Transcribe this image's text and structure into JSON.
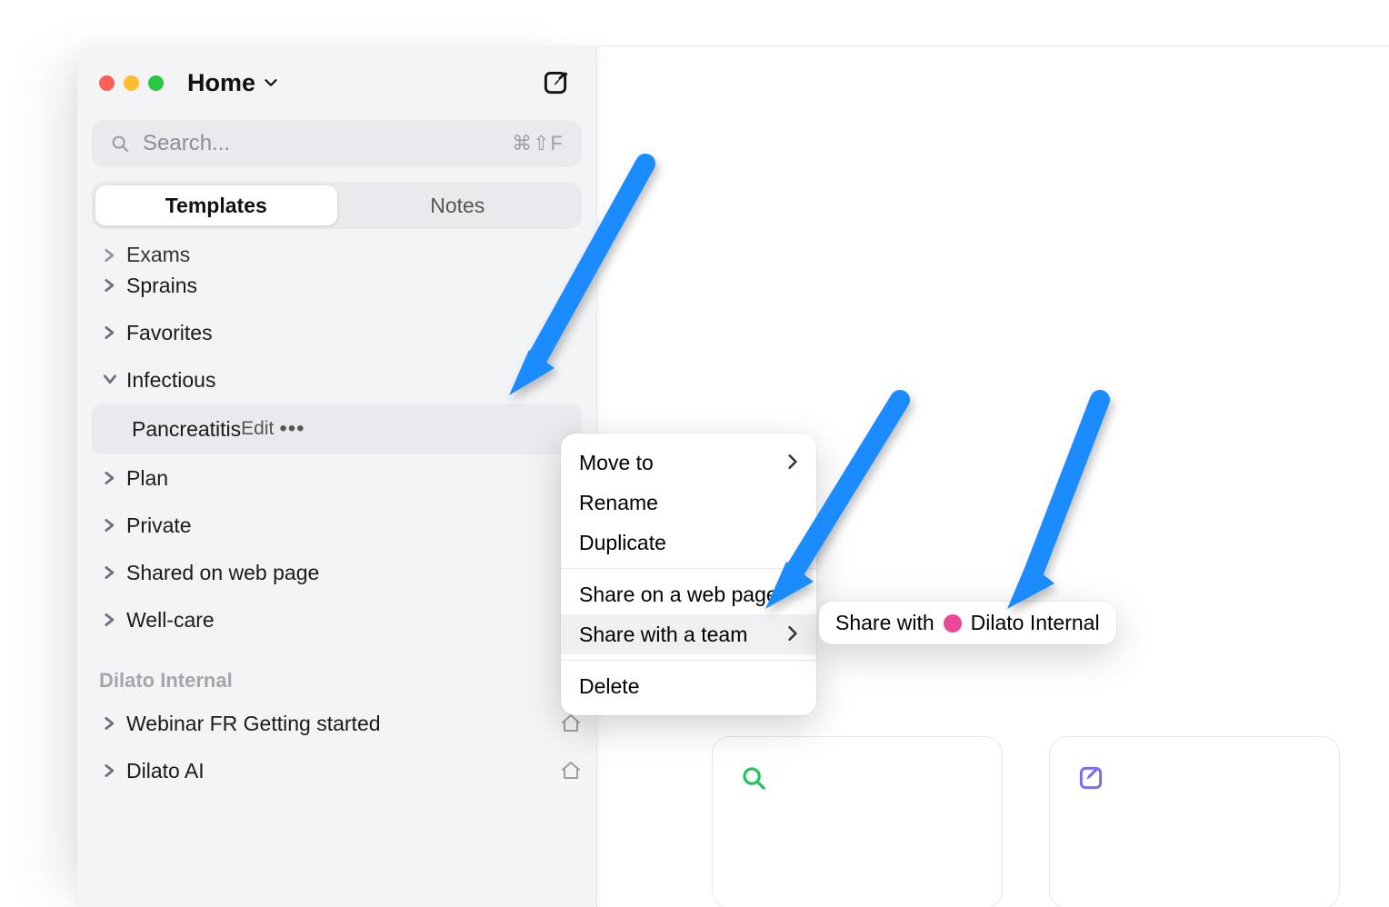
{
  "titlebar": {
    "title": "Home"
  },
  "search": {
    "placeholder": "Search...",
    "shortcut": "⌘⇧F"
  },
  "tabs": {
    "templates": "Templates",
    "notes": "Notes"
  },
  "tree": {
    "cut_item": "Exams",
    "items": [
      {
        "label": "Sprains",
        "expanded": false
      },
      {
        "label": "Favorites",
        "expanded": false
      },
      {
        "label": "Infectious",
        "expanded": true,
        "children": [
          {
            "label": "Pancreatitis",
            "edit": "Edit"
          }
        ]
      },
      {
        "label": "Plan",
        "expanded": false
      },
      {
        "label": "Private",
        "expanded": false
      },
      {
        "label": "Shared on web page",
        "expanded": false
      },
      {
        "label": "Well-care",
        "expanded": false
      }
    ]
  },
  "section": {
    "title": "Dilato Internal",
    "items": [
      {
        "label": "Webinar FR Getting started",
        "home": true
      },
      {
        "label": "Dilato AI",
        "home": true
      }
    ]
  },
  "menu": {
    "move_to": "Move to",
    "rename": "Rename",
    "duplicate": "Duplicate",
    "share_web": "Share on a web page",
    "share_team": "Share with a team",
    "delete": "Delete"
  },
  "submenu": {
    "prefix": "Share with",
    "team": "Dilato Internal"
  }
}
